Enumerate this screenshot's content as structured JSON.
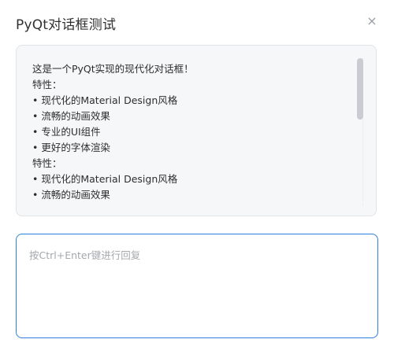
{
  "window": {
    "title": "PyQt对话框测试",
    "close_glyph": "×",
    "close_icon": "close-icon"
  },
  "message": {
    "lines": [
      "这是一个PyQt实现的现代化对话框！",
      "特性：",
      "• 现代化的Material Design风格",
      "• 流畅的动画效果",
      "• 专业的UI组件",
      "• 更好的字体渲染",
      "特性：",
      "• 现代化的Material Design风格",
      "• 流畅的动画效果"
    ]
  },
  "reply": {
    "value": "",
    "placeholder": "按Ctrl+Enter键进行回复"
  },
  "colors": {
    "accent": "#2f7de1",
    "panel_bg": "#f6f7f9",
    "panel_border": "#e1e4e8"
  }
}
